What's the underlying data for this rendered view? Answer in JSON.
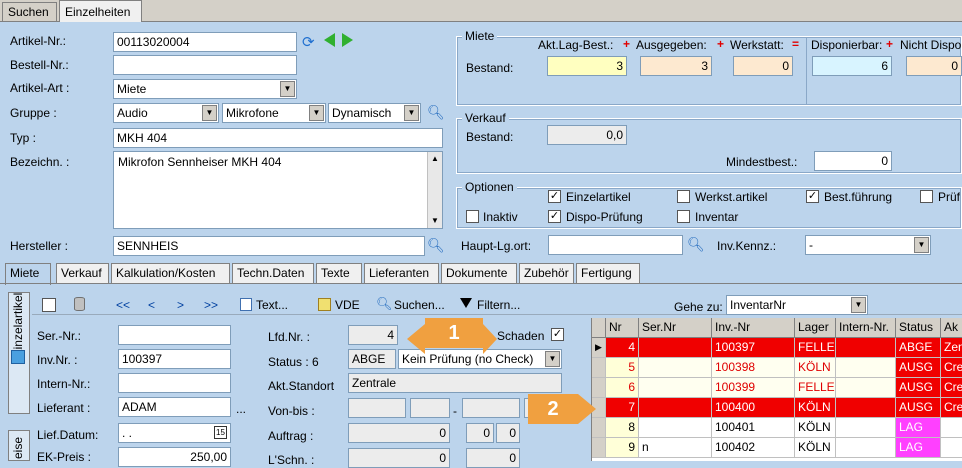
{
  "top_tabs": [
    "Suchen",
    "Einzelheiten"
  ],
  "fields": {
    "artikel_nr_label": "Artikel-Nr.:",
    "artikel_nr": "00113020004",
    "bestell_nr_label": "Bestell-Nr.:",
    "bestell_nr": "",
    "artikel_art_label": "Artikel-Art :",
    "artikel_art": "Miete",
    "gruppe_label": "Gruppe :",
    "gruppe1": "Audio",
    "gruppe2": "Mikrofone",
    "gruppe3": "Dynamisch",
    "typ_label": "Typ :",
    "typ": "MKH 404",
    "bezeichn_label": "Bezeichn. :",
    "bezeichn": "Mikrofon Sennheiser MKH 404",
    "hersteller_label": "Hersteller :",
    "hersteller": "SENNHEIS"
  },
  "miete": {
    "title": "Miete",
    "bestand_label": "Bestand:",
    "col_akt": "Akt.Lag-Best.:",
    "col_ausg": "Ausgegeben:",
    "col_werk": "Werkstatt:",
    "col_dispo": "Disponierbar:",
    "col_nicht": "Nicht Dispo",
    "akt": "3",
    "ausg": "3",
    "werk": "0",
    "dispo": "6",
    "nicht": "0",
    "plus": "+",
    "eq": "="
  },
  "verkauf": {
    "title": "Verkauf",
    "bestand_label": "Bestand:",
    "bestand": "0,0",
    "mindest_label": "Mindestbest.:",
    "mindest": "0"
  },
  "optionen": {
    "title": "Optionen",
    "einzelartikel": "Einzelartikel",
    "werkst": "Werkst.artikel",
    "bestf": "Best.führung",
    "pruef": "Prüf",
    "inaktiv": "Inaktiv",
    "dispo": "Dispo-Prüfung",
    "inventar": "Inventar",
    "check": "✓"
  },
  "haupt": {
    "label": "Haupt-Lg.ort:",
    "value": "",
    "invkennz_label": "Inv.Kennz.:",
    "invkennz": "-"
  },
  "sub_tabs": [
    "Miete",
    "Verkauf",
    "Kalkulation/Kosten",
    "Techn.Daten",
    "Texte",
    "Lieferanten",
    "Dokumente",
    "Zubehör",
    "Fertigung"
  ],
  "side_tab": "Einzelartikel",
  "side_tab2": "eise",
  "toolbar": {
    "first": "<<",
    "prev": "<",
    "next": ">",
    "last": ">>",
    "text": "Text...",
    "vde": "VDE",
    "suchen": "Suchen...",
    "filtern": "Filtern...",
    "gehe_zu": "Gehe zu:",
    "gehe_value": "InventarNr"
  },
  "detail": {
    "ser_label": "Ser.-Nr.:",
    "ser": "",
    "inv_label": "Inv.Nr. :",
    "inv": "100397",
    "intern_label": "Intern-Nr.:",
    "intern": "",
    "lief_label": "Lieferant :",
    "lief": "ADAM",
    "lief_more": "...",
    "liefdat_label": "Lief.Datum:",
    "liefdat": ". .",
    "ek_label": "EK-Preis :",
    "ek": "250,00",
    "lfd_label": "Lfd.Nr. :",
    "lfd": "4",
    "status_label": "Status : 6",
    "status_code": "ABGE",
    "status_text": "Kein Prüfung (no Check)",
    "schaden_label": "Schaden",
    "standort_label": "Akt.Standort",
    "standort": "Zentrale",
    "vonbis_label": "Von-bis :",
    "dash": "-",
    "auftrag_label": "Auftrag :",
    "auftrag1": "0",
    "auftrag2": "0",
    "auftrag3": "0",
    "lschn_label": "L'Schn. :",
    "lschn1": "0",
    "lschn2": "0"
  },
  "grid": {
    "headers": [
      "Nr",
      "Ser.Nr",
      "Inv.-Nr",
      "Lager",
      "Intern-Nr.",
      "Status",
      "Ak"
    ],
    "rows": [
      {
        "nr": "4",
        "ser": "",
        "inv": "100397",
        "lager": "FELLE",
        "intern": "",
        "status": "ABGE",
        "ak": "Zen"
      },
      {
        "nr": "5",
        "ser": "",
        "inv": "100398",
        "lager": "KÖLN",
        "intern": "",
        "status": "AUSG",
        "ak": "Cre"
      },
      {
        "nr": "6",
        "ser": "",
        "inv": "100399",
        "lager": "FELLE",
        "intern": "",
        "status": "AUSG",
        "ak": "Cre"
      },
      {
        "nr": "7",
        "ser": "",
        "inv": "100400",
        "lager": "KÖLN",
        "intern": "",
        "status": "AUSG",
        "ak": "Cre"
      },
      {
        "nr": "8",
        "ser": "",
        "inv": "100401",
        "lager": "KÖLN",
        "intern": "",
        "status": "LAG",
        "ak": ""
      },
      {
        "nr": "9",
        "ser": "n",
        "inv": "100402",
        "lager": "KÖLN",
        "intern": "",
        "status": "LAG",
        "ak": ""
      }
    ]
  },
  "badges": [
    "1",
    "2"
  ],
  "colors": {
    "red": "#f00000",
    "pink": "#ff40ff",
    "darkred_text": "#e00000"
  }
}
